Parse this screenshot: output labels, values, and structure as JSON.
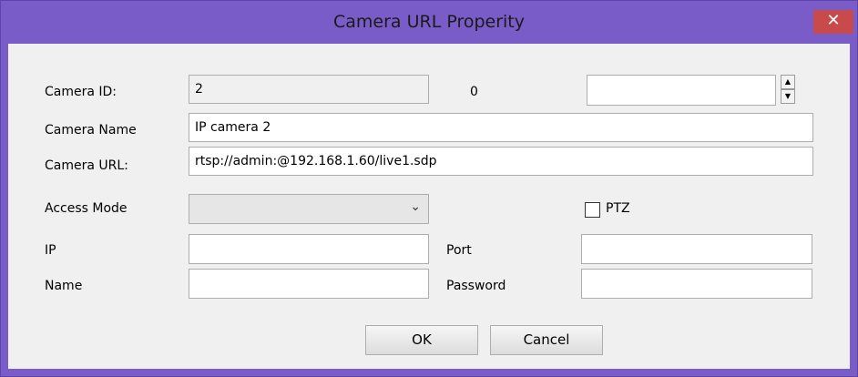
{
  "window": {
    "title": "Camera URL Properity",
    "close_glyph": "✕"
  },
  "labels": {
    "camera_id": "Camera ID:",
    "camera_name": "Camera Name",
    "camera_url": "Camera URL:",
    "access_mode": "Access Mode",
    "ip": "IP",
    "name": "Name",
    "port": "Port",
    "password": "Password",
    "ptz": "PTZ",
    "zero_value": "0"
  },
  "fields": {
    "camera_id": "2",
    "camera_name": "IP camera 2",
    "camera_url": "rtsp://admin:@192.168.1.60/live1.sdp",
    "spin_value": "",
    "access_mode": "",
    "ip": "",
    "port": "",
    "name": "",
    "password": ""
  },
  "checkbox": {
    "ptz_checked": false
  },
  "buttons": {
    "ok": "OK",
    "cancel": "Cancel"
  },
  "icons": {
    "chevron": "chevron-down-icon",
    "spin_up": "up-arrow-icon",
    "spin_down": "down-arrow-icon"
  }
}
